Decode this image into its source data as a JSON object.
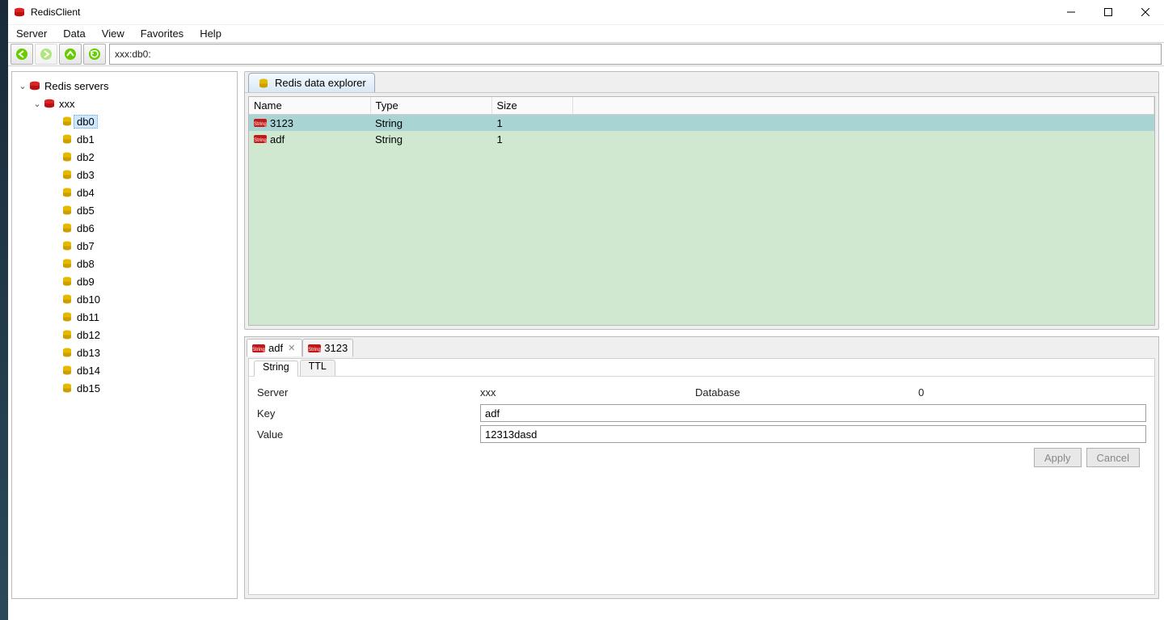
{
  "app": {
    "title": "RedisClient"
  },
  "menu": {
    "items": [
      "Server",
      "Data",
      "View",
      "Favorites",
      "Help"
    ]
  },
  "toolbar": {
    "address": "xxx:db0:"
  },
  "tree": {
    "root_label": "Redis servers",
    "server_label": "xxx",
    "selected_db": "db0",
    "dbs": [
      "db0",
      "db1",
      "db2",
      "db3",
      "db4",
      "db5",
      "db6",
      "db7",
      "db8",
      "db9",
      "db10",
      "db11",
      "db12",
      "db13",
      "db14",
      "db15"
    ]
  },
  "explorer": {
    "tab_label": "Redis data explorer",
    "columns": {
      "name": "Name",
      "type": "Type",
      "size": "Size"
    },
    "rows": [
      {
        "name": "3123",
        "type": "String",
        "size": "1",
        "selected": true
      },
      {
        "name": "adf",
        "type": "String",
        "size": "1",
        "selected": false
      }
    ]
  },
  "detail": {
    "tabs": [
      {
        "label": "adf",
        "active": true
      },
      {
        "label": "3123",
        "active": false
      }
    ],
    "subtabs": {
      "string": "String",
      "ttl": "TTL"
    },
    "labels": {
      "server": "Server",
      "database": "Database",
      "key": "Key",
      "value": "Value"
    },
    "server": "xxx",
    "database": "0",
    "key": "adf",
    "value": "12313dasd",
    "buttons": {
      "apply": "Apply",
      "cancel": "Cancel"
    }
  }
}
